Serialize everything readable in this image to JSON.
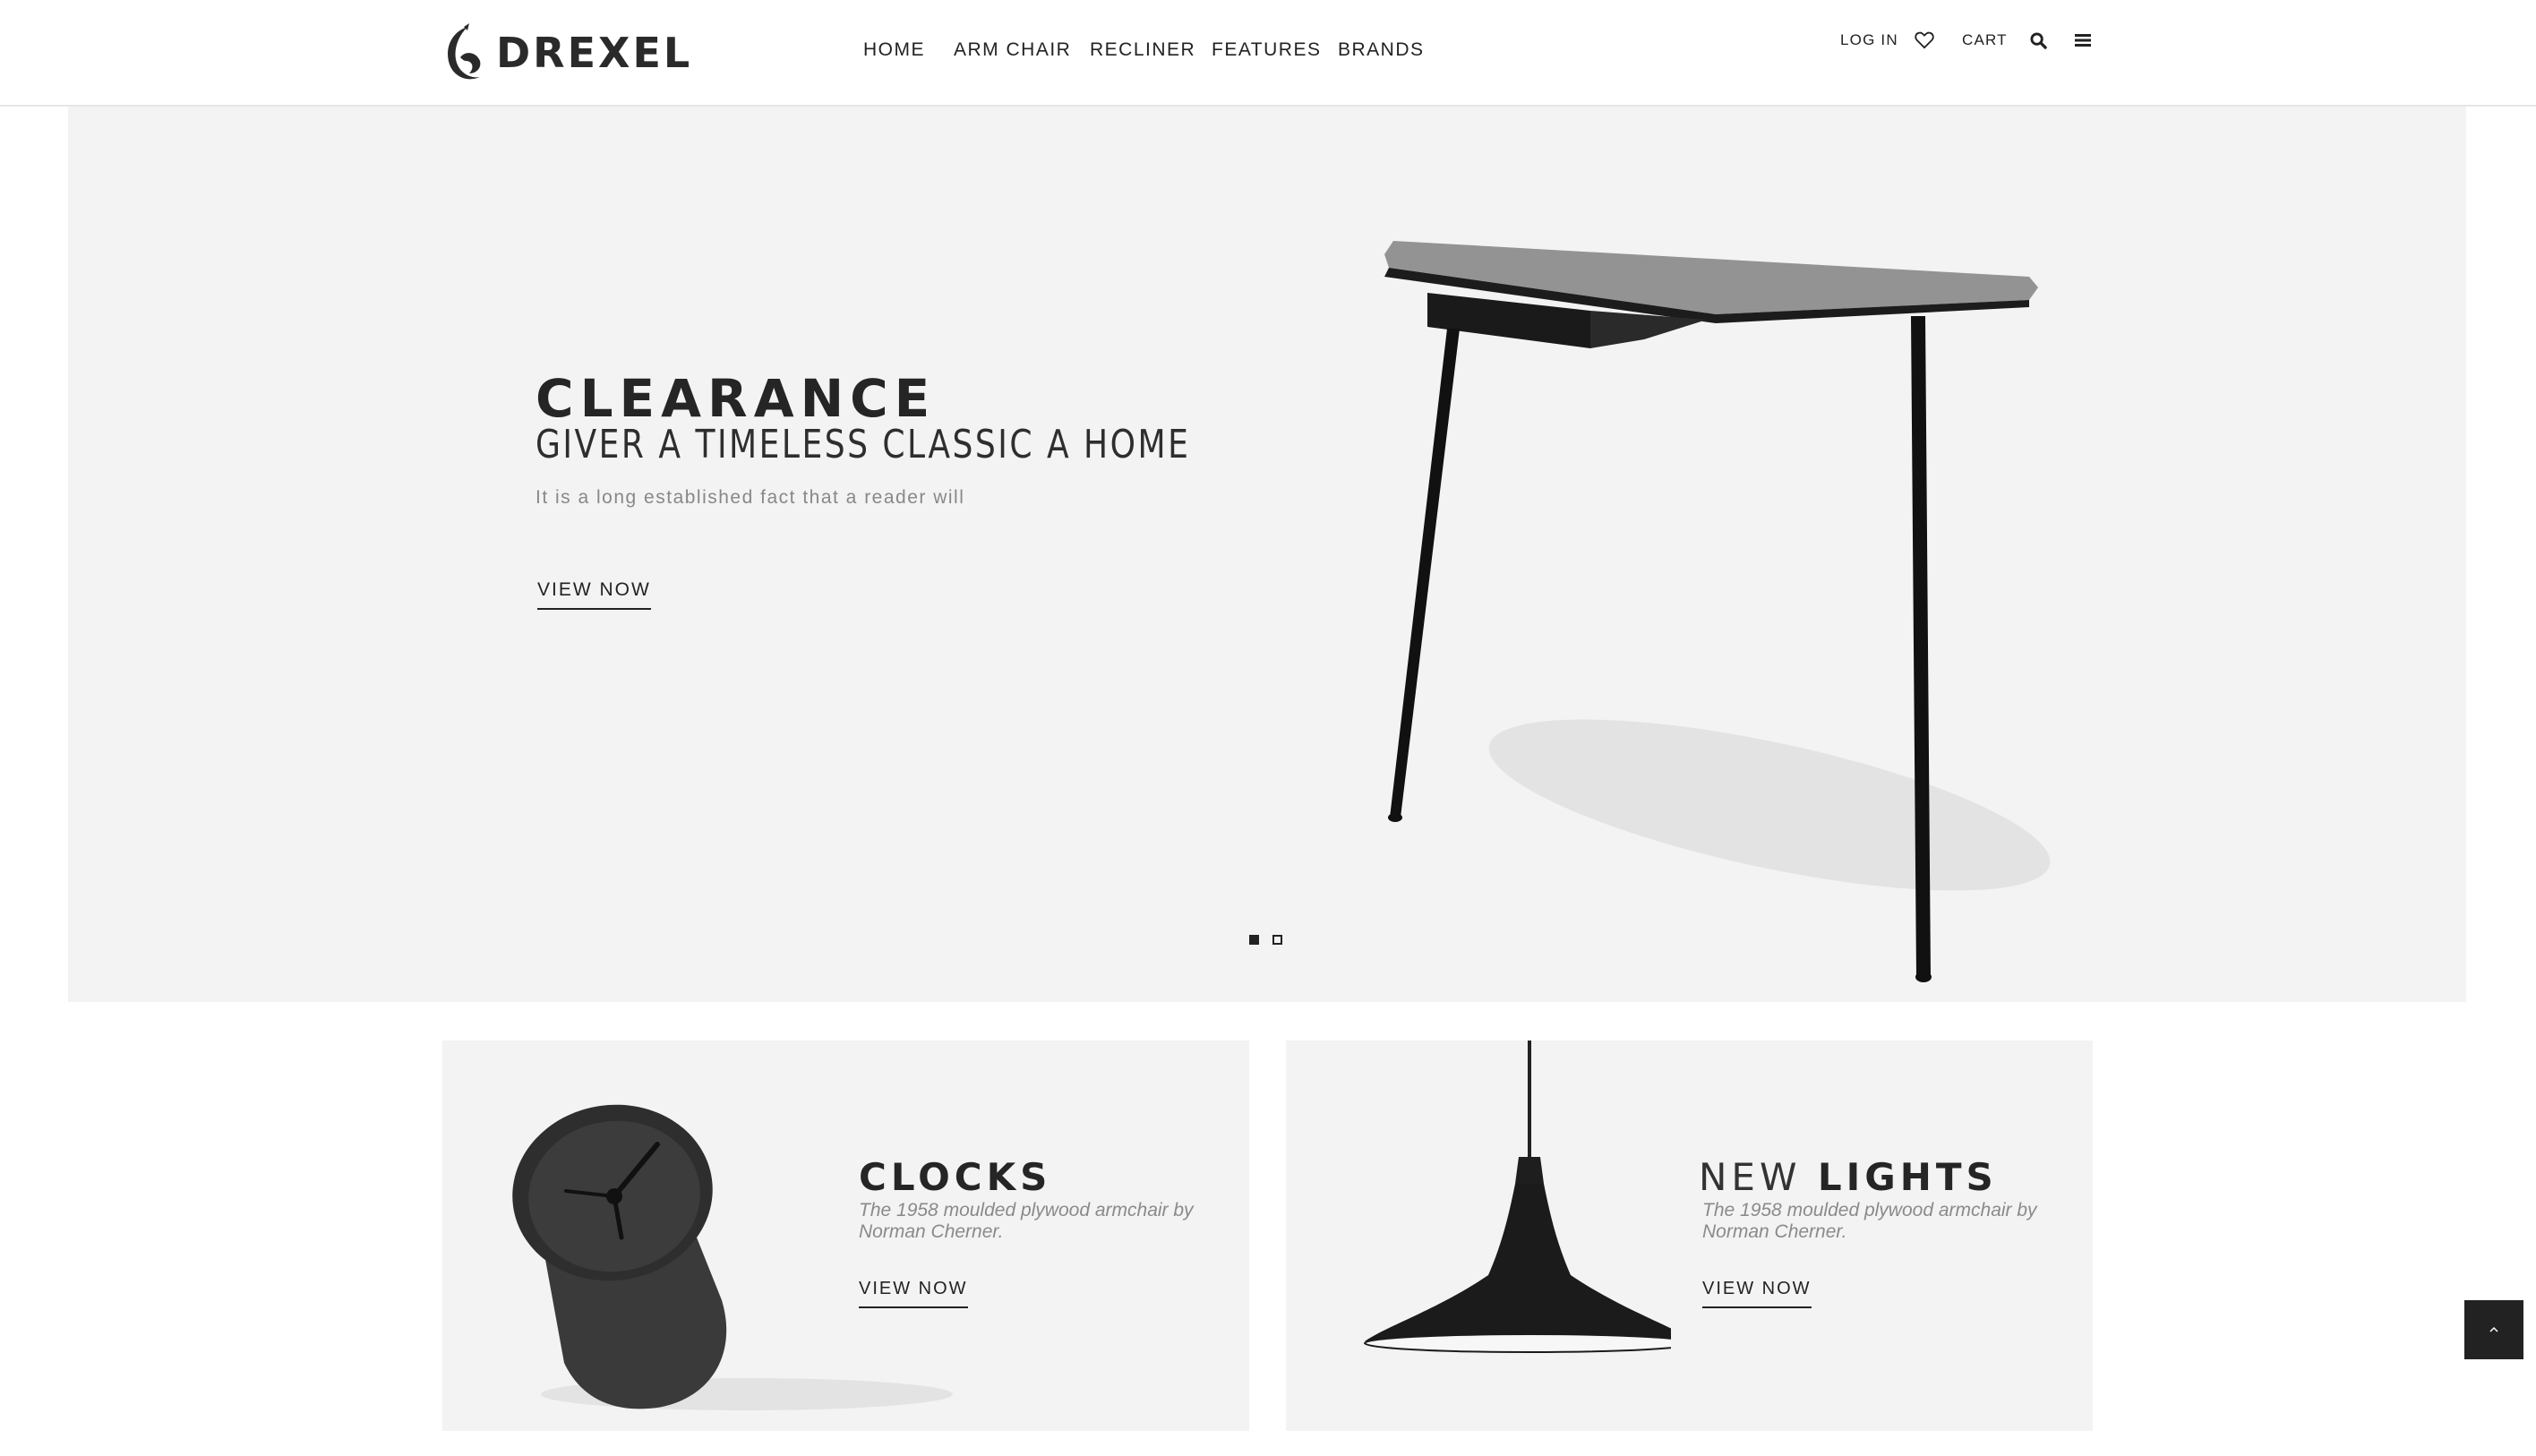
{
  "brand": {
    "name": "DREXEL"
  },
  "nav": {
    "items": [
      "HOME",
      "ARM CHAIR",
      "RECLINER",
      "FEATURES",
      "BRANDS"
    ]
  },
  "util": {
    "login_label": "LOG IN",
    "cart_label": "CART",
    "icons": [
      "heart-icon",
      "search-icon",
      "menu-icon"
    ]
  },
  "hero": {
    "title": "CLEARANCE",
    "subtitle": "GIVER A TIMELESS CLASSIC A HOME",
    "description": "It is a long established fact that a reader will",
    "cta_label": "VIEW NOW",
    "slides_total": 2,
    "active_slide": 1
  },
  "banners": [
    {
      "title_light": "",
      "title_bold": "CLOCKS",
      "description": "The 1958 moulded plywood armchair by Norman Cherner.",
      "cta_label": "VIEW NOW"
    },
    {
      "title_light": "NEW ",
      "title_bold": "LIGHTS",
      "description": "The 1958 moulded plywood armchair by Norman Cherner.",
      "cta_label": "VIEW NOW"
    }
  ],
  "colors": {
    "text": "#222222",
    "panel_bg": "#f3f3f3",
    "muted": "#888888"
  }
}
